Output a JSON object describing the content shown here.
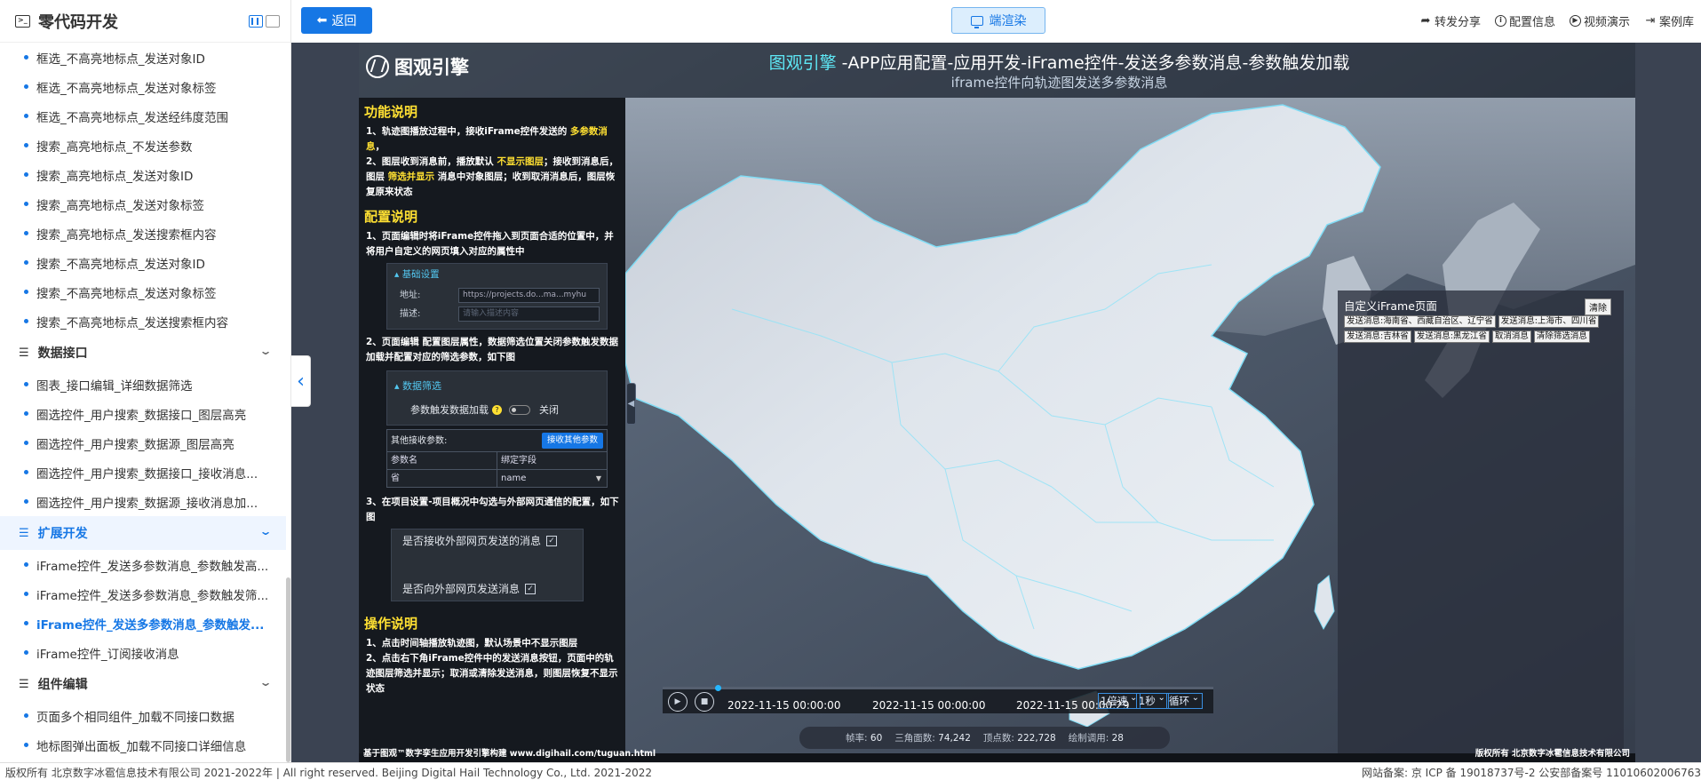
{
  "sidebar": {
    "title": "零代码开发",
    "items_top": [
      "框选_不高亮地标点_发送对象ID",
      "框选_不高亮地标点_发送对象标签",
      "框选_不高亮地标点_发送经纬度范围",
      "搜索_高亮地标点_不发送参数",
      "搜索_高亮地标点_发送对象ID",
      "搜索_高亮地标点_发送对象标签",
      "搜索_高亮地标点_发送搜索框内容",
      "搜索_不高亮地标点_发送对象ID",
      "搜索_不高亮地标点_发送对象标签",
      "搜索_不高亮地标点_发送搜索框内容"
    ],
    "group_data": "数据接口",
    "items_data": [
      "图表_接口编辑_详细数据筛选",
      "圈选控件_用户搜索_数据接口_图层高亮",
      "圈选控件_用户搜索_数据源_图层高亮",
      "圈选控件_用户搜索_数据接口_接收消息...",
      "圈选控件_用户搜索_数据源_接收消息加..."
    ],
    "group_ext": "扩展开发",
    "items_ext": [
      "iFrame控件_发送多参数消息_参数触发高...",
      "iFrame控件_发送多参数消息_参数触发筛...",
      "iFrame控件_发送多参数消息_参数触发...",
      "iFrame控件_订阅接收消息"
    ],
    "group_comp": "组件编辑",
    "items_comp": [
      "页面多个相同组件_加载不同接口数据",
      "地标图弹出面板_加载不同接口详细信息"
    ]
  },
  "toolbar": {
    "back_label": "返回",
    "render_label": "端渲染",
    "share_label": "转发分享",
    "config_label": "配置信息",
    "video_label": "视频演示",
    "cases_label": "案例库"
  },
  "scene": {
    "logo_text": "图观引擎",
    "title_highlight": "图观引擎",
    "title_rest": " -APP应用配置-应用开发-iFrame控件-发送多参数消息-参数触发加载",
    "subtitle": "iframe控件向轨迹图发送多参数消息",
    "func_title": "功能说明",
    "func_p1_a": "1、轨迹图播放过程中，接收iFrame控件发送的 ",
    "func_p1_hl": "多参数消息",
    "func_p1_b": "，",
    "func_p2_a": "2、图层收到消息前，播放默认 ",
    "func_p2_hl1": "不显示图层",
    "func_p2_b": "；接收到消息后，图层 ",
    "func_p2_hl2": "筛选并显示",
    "func_p2_c": " 消息中对象图层；收到取消消息后，图层恢复原来状态",
    "cfg_title": "配置说明",
    "cfg_p1": "1、页面编辑时将iFrame控件拖入到页面合适的位置中，并将用户自定义的网页填入对应的属性中",
    "cfg_box_cap": "▴ 基础设置",
    "cfg_addr_label": "地址:",
    "cfg_addr_value": "https://projects.do...ma...myhu",
    "cfg_desc_label": "描述:",
    "cfg_desc_placeholder": "请输入描述内容",
    "cfg_p2": "2、页面编辑 配置图层属性，数据筛选位置关闭参数触发数据加载并配置对应的筛选参数，如下图",
    "flt_cap": "▴ 数据筛选",
    "flt_label": "参数触发数据加载",
    "flt_q": "?",
    "flt_state": "关闭",
    "tbl_label": "其他接收参数:",
    "tbl_btn": "接收其他参数",
    "tbl_col1": "参数名",
    "tbl_col2": "绑定字段",
    "tbl_val1": "省",
    "tbl_val2": "name",
    "cfg_p3": "3、在项目设置-项目概况中勾选与外部网页通信的配置，如下图",
    "chk1": "是否接收外部网页发送的消息",
    "chk2": "是否向外部网页发送消息",
    "op_title": "操作说明",
    "op_p1": "1、点击时间轴播放轨迹图，默认场景中不显示图层",
    "op_p2": "2、点击右下角iFrame控件中的发送消息按钮，页面中的轨迹图层筛选并显示；取消或清除发送消息，则图层恢复不显示状态",
    "iframe_title": "自定义iFrame页面",
    "iframe_clear": "清除",
    "iframe_buttons": [
      "发送消息:海南省、西藏自治区、辽宁省",
      "发送消息:上海市、四川省",
      "发送消息:吉林省",
      "发送消息:黑龙江省",
      "取消消息",
      "清除筛选消息"
    ],
    "time_start": "2022-11-15 00:00:00",
    "time_mid": "2022-11-15 00:00:00",
    "time_end": "2022-11-15 00:00:29",
    "speed": "1倍速",
    "interval": "1秒",
    "loop": "循环",
    "progress": 0.1,
    "stats": {
      "fps_label": "帧率:",
      "fps": "60",
      "tri_label": "三角面数:",
      "tri": "74,242",
      "vert_label": "顶点数:",
      "vert": "222,728",
      "draw_label": "绘制调用:",
      "draw": "28"
    },
    "footer_left": "基于图观™数字孪生应用开发引擎构建 www.digihail.com/tuguan.html",
    "footer_right": "版权所有 北京数字冰雹信息技术有限公司"
  },
  "footer": {
    "left": "版权所有 北京数字冰雹信息技术有限公司 2021-2022年 | All right reserved. Beijing Digital Hail Technology Co., Ltd. 2021-2022",
    "right": "网站备案: 京 ICP 备 19018737号-2 公安部备案号 11010602006763"
  },
  "colors": {
    "accent": "#1677e5",
    "highlight_yellow": "#ffe032",
    "title_cyan": "#5ee8f6"
  }
}
